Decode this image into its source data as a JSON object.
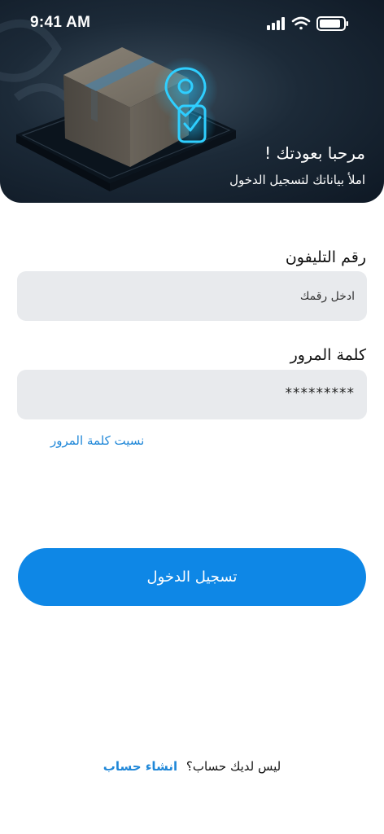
{
  "status_bar": {
    "time": "9:41 AM",
    "icons": [
      "signal-icon",
      "wifi-icon",
      "battery-icon"
    ]
  },
  "hero": {
    "title": "مرحبا بعودتك !",
    "subtitle": "املأ بياناتك لتسجيل الدخول"
  },
  "form": {
    "phone_label": "رقم التليفون",
    "phone_placeholder": "ادخل رقمك",
    "password_label": "كلمة المرور",
    "password_value": "*********",
    "forgot_password": "نسيت كلمة المرور"
  },
  "actions": {
    "login_label": "تسجيل الدخول"
  },
  "signup": {
    "question": "ليس لديك حساب؟",
    "link": "انشاء حساب"
  },
  "colors": {
    "accent": "#0e87e6",
    "link": "#1f87d8",
    "input_bg": "#e8eaed",
    "hero_bg": "#1c2a38"
  }
}
